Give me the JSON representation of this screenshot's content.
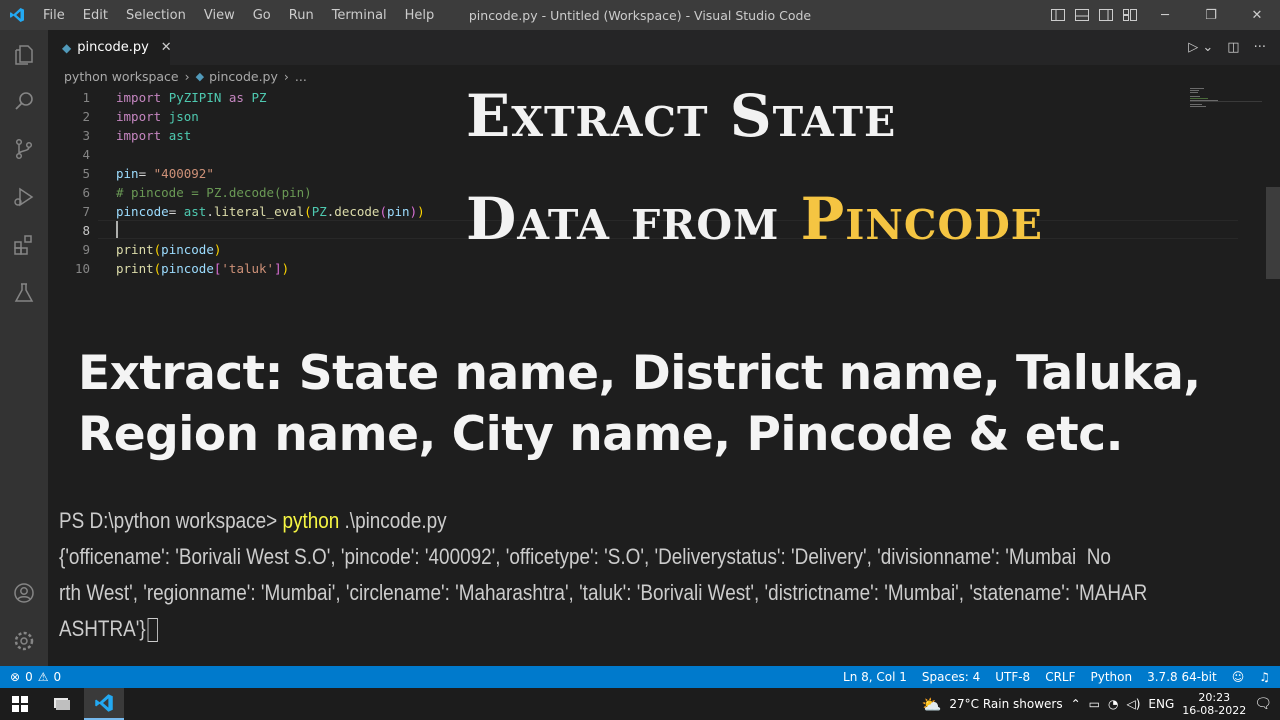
{
  "titlebar": {
    "menu": [
      "File",
      "Edit",
      "Selection",
      "View",
      "Go",
      "Run",
      "Terminal",
      "Help"
    ],
    "window_title": "pincode.py - Untitled (Workspace) - Visual Studio Code",
    "icons": [
      "layout-sidebar-icon",
      "layout-panel-icon",
      "layout-sidebar-right-icon",
      "customize-layout-icon",
      "minimize-icon",
      "restore-icon",
      "close-icon"
    ]
  },
  "activitybar": {
    "items": [
      "explorer-icon",
      "search-icon",
      "source-control-icon",
      "run-debug-icon",
      "extensions-icon",
      "testing-icon"
    ],
    "bottom": [
      "accounts-icon",
      "manage-gear-icon"
    ]
  },
  "tab": {
    "label": "pincode.py",
    "close": "✕"
  },
  "breadcrumb": {
    "folder": "python workspace",
    "file": "pincode.py",
    "more": "..."
  },
  "code": {
    "line_numbers": [
      "1",
      "2",
      "3",
      "4",
      "5",
      "6",
      "7",
      "8",
      "9",
      "10"
    ],
    "l1_kw": "import",
    "l1_mod": "PyZIPIN",
    "l1_as": "as",
    "l1_alias": "PZ",
    "l2_kw": "import",
    "l2_mod": "json",
    "l3_kw": "import",
    "l3_mod": "ast",
    "l5_var": "pin",
    "l5_eq": "= ",
    "l5_str": "\"400092\"",
    "l6_comment": "# pincode = PZ.decode(pin)",
    "l7_var": "pincode",
    "l7_eq": "= ",
    "l7_mod": "ast",
    "l7_dot": ".",
    "l7_fn": "literal_eval",
    "l7_p1": "(",
    "l7_mod2": "PZ",
    "l7_dot2": ".",
    "l7_fn2": "decode",
    "l7_p2": "(",
    "l7_arg": "pin",
    "l7_p3": ")",
    "l7_p4": ")",
    "l9_fn": "print",
    "l9_p1": "(",
    "l9_arg": "pincode",
    "l9_p2": ")",
    "l10_fn": "print",
    "l10_p1": "(",
    "l10_arg": "pincode",
    "l10_b1": "[",
    "l10_str": "'taluk'",
    "l10_b2": "]",
    "l10_p2": ")"
  },
  "overlay": {
    "line1": "Extract State",
    "line2_a": "Data from ",
    "line2_b": "Pincode",
    "line3": "Extract: State name, District name, Taluka,",
    "line4": "Region name, City name, Pincode & etc."
  },
  "terminal": {
    "prompt": "PS D:\\python workspace> ",
    "cmd": "python",
    "args": " .\\pincode.py",
    "out1": "{'officename': 'Borivali West S.O', 'pincode': '400092', 'officetype': 'S.O', 'Deliverystatus': 'Delivery', 'divisionname': 'Mumbai  No",
    "out2": "rth West', 'regionname': 'Mumbai', 'circlename': 'Maharashtra', 'taluk': 'Borivali West', 'districtname': 'Mumbai', 'statename': 'MAHAR",
    "out3": "ASHTRA'}"
  },
  "statusbar": {
    "errors": "0",
    "warnings": "0",
    "position": "Ln 8, Col 1",
    "spaces": "Spaces: 4",
    "encoding": "UTF-8",
    "eol": "CRLF",
    "language": "Python",
    "interpreter": "3.7.8 64-bit"
  },
  "taskbar": {
    "weather": "27°C  Rain showers",
    "lang": "ENG",
    "time": "20:23",
    "date": "16-08-2022"
  },
  "colors": {
    "accent": "#007acc",
    "highlight": "#f5c542"
  }
}
